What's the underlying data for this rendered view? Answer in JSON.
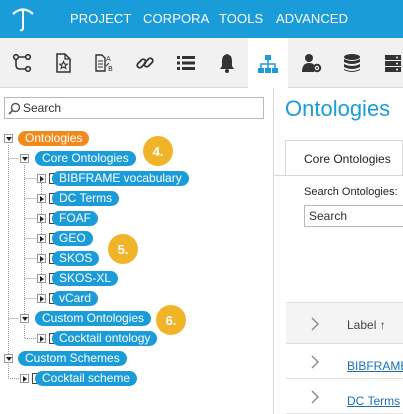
{
  "colors": {
    "brand": "#1a9cd8",
    "root_node": "#f08a1d",
    "badge": "#f0b429",
    "link": "#1a6fb5"
  },
  "menu": {
    "items": [
      "PROJECT",
      "CORPORA",
      "TOOLS",
      "ADVANCED"
    ]
  },
  "logo_icon": "umbrella-logo",
  "toolbar": {
    "icons": [
      "flow-icon",
      "starred-doc-icon",
      "doc-ab-icon",
      "link-icon",
      "list-icon",
      "bell-icon",
      "hierarchy-icon",
      "user-gear-icon",
      "database-icon",
      "server-icon"
    ],
    "active": "hierarchy-icon"
  },
  "left": {
    "search_placeholder": "Search",
    "tree": {
      "ontologies": "Ontologies",
      "core": "Core Ontologies",
      "core_items": [
        "BIBFRAME vocabulary",
        "DC Terms",
        "FOAF",
        "GEO",
        "SKOS",
        "SKOS-XL",
        "vCard"
      ],
      "custom": "Custom Ontologies",
      "custom_items": [
        "Cocktail ontology"
      ],
      "schemes": "Custom Schemes",
      "scheme_items": [
        "Cocktail scheme"
      ]
    },
    "badges": [
      "4.",
      "5.",
      "6."
    ]
  },
  "right": {
    "title": "Ontologies",
    "tab": "Core Ontologies",
    "search_label": "Search Ontologies:",
    "search_placeholder": "Search",
    "table_header": "Label ↑",
    "rows": [
      "BIBFRAME",
      "DC Terms"
    ]
  }
}
